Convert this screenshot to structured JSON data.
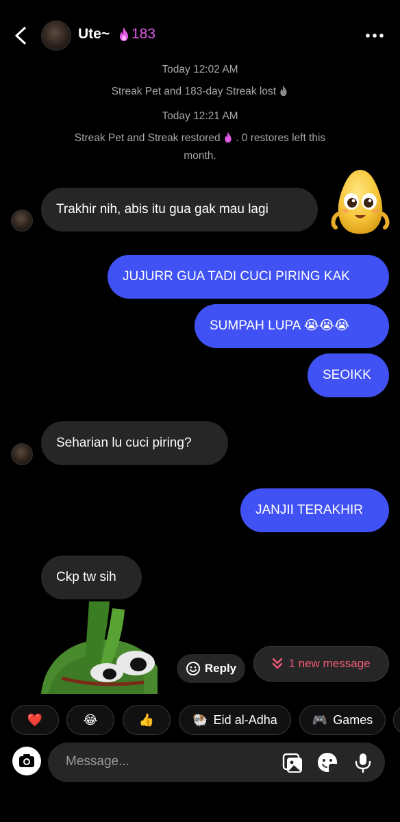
{
  "header": {
    "contact_name": "Ute~",
    "streak_count": "183"
  },
  "system_messages": [
    "Today 12:02 AM",
    "Streak Pet and 183-day Streak lost",
    "Today 12:21 AM",
    "Streak Pet and Streak restored",
    ". 0 restores left this",
    "month."
  ],
  "messages": [
    {
      "dir": "in",
      "text": "Trakhir nih, abis itu gua gak mau lagi"
    },
    {
      "dir": "out",
      "text": "JUJURR GUA TADI CUCI PIRING KAK"
    },
    {
      "dir": "out",
      "text": "SUMPAH LUPA",
      "emoji": "😭😭😭"
    },
    {
      "dir": "out",
      "text": "SEOIKK"
    },
    {
      "dir": "in",
      "text": "Seharian lu cuci piring?"
    },
    {
      "dir": "out",
      "text": "JANJII TERAKHIR"
    },
    {
      "dir": "in",
      "text": "Ckp tw sih"
    }
  ],
  "actions": {
    "reply_label": "Reply",
    "new_message_label": "1 new message"
  },
  "quick_reactions": [
    {
      "emoji": "❤️",
      "label": ""
    },
    {
      "emoji": "😂",
      "label": ""
    },
    {
      "emoji": "👍",
      "label": ""
    },
    {
      "emoji": "🐏",
      "label": "Eid al-Adha"
    },
    {
      "emoji": "🎮",
      "label": "Games"
    }
  ],
  "composer": {
    "placeholder": "Message..."
  },
  "icons": [
    "back-icon",
    "more-icon",
    "flame-icon",
    "camera-icon",
    "gallery-icon",
    "sticker-icon",
    "microphone-icon",
    "reply-smiley-icon",
    "chevron-double-down-icon"
  ],
  "colors": {
    "outgoing_bubble": "#4152f5",
    "incoming_bubble": "#262626",
    "streak": "#e25ce8",
    "new_message": "#f25a78",
    "background": "#000000"
  }
}
